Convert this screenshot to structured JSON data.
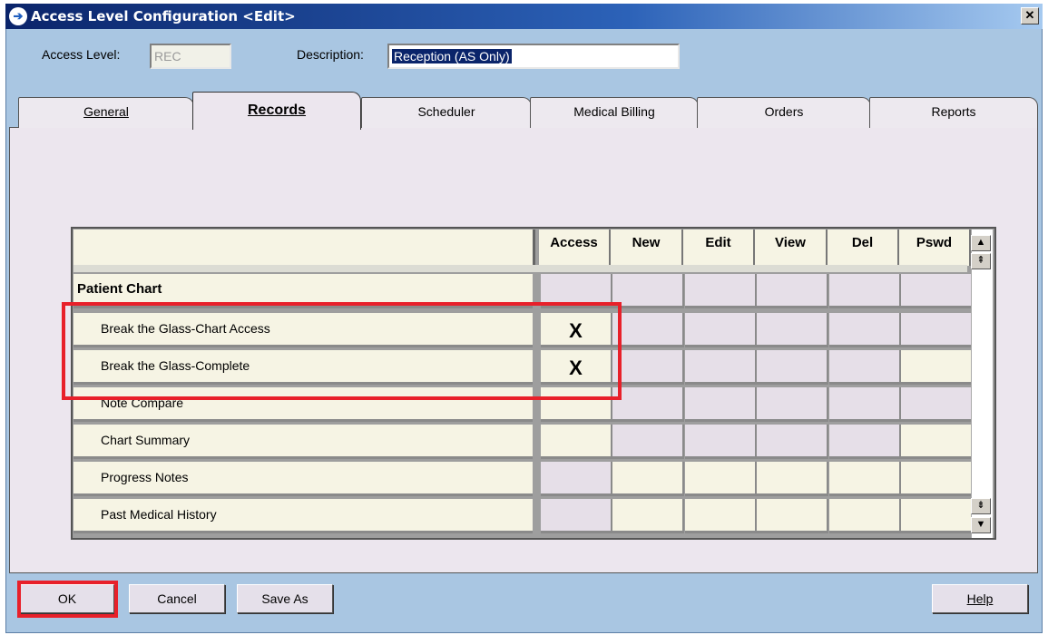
{
  "window": {
    "title": "Access Level Configuration <Edit>",
    "close_glyph": "✕",
    "app_icon": "arrow-circle-icon"
  },
  "header": {
    "access_level_label": "Access Level:",
    "access_level_value": "REC",
    "description_label": "Description:",
    "description_value": "Reception (AS Only)"
  },
  "tabs": [
    {
      "label": "General",
      "active": false
    },
    {
      "label": "Records",
      "active": true
    },
    {
      "label": "Scheduler",
      "active": false
    },
    {
      "label": "Medical Billing",
      "active": false
    },
    {
      "label": "Orders",
      "active": false
    },
    {
      "label": "Reports",
      "active": false
    }
  ],
  "grid": {
    "columns": [
      "Access",
      "New",
      "Edit",
      "View",
      "Del",
      "Pswd"
    ],
    "rows": [
      {
        "label": "Patient Chart",
        "section": true,
        "cells": [
          "",
          "",
          "",
          "",
          "",
          ""
        ]
      },
      {
        "label": "Break the Glass-Chart Access",
        "section": false,
        "cells": [
          "X",
          "",
          "",
          "",
          "",
          ""
        ]
      },
      {
        "label": "Break the Glass-Complete",
        "section": false,
        "cells": [
          "X",
          "",
          "",
          "",
          "",
          ""
        ]
      },
      {
        "label": "Note Compare",
        "section": false,
        "cells": [
          "",
          "",
          "",
          "",
          "",
          ""
        ]
      },
      {
        "label": "Chart Summary",
        "section": false,
        "cells": [
          "",
          "",
          "",
          "",
          "",
          ""
        ]
      },
      {
        "label": "Progress Notes",
        "section": false,
        "cells": [
          "",
          "",
          "",
          "",
          "",
          ""
        ]
      },
      {
        "label": "Past Medical History",
        "section": false,
        "cells": [
          "",
          "",
          "",
          "",
          "",
          ""
        ]
      }
    ]
  },
  "footer": {
    "ok_label": "OK",
    "cancel_label": "Cancel",
    "save_as_label": "Save As",
    "help_label": "Help"
  },
  "colors": {
    "highlight": "#e8202a",
    "window_bg": "#a9c6e2",
    "panel_bg": "#ece6ee"
  }
}
